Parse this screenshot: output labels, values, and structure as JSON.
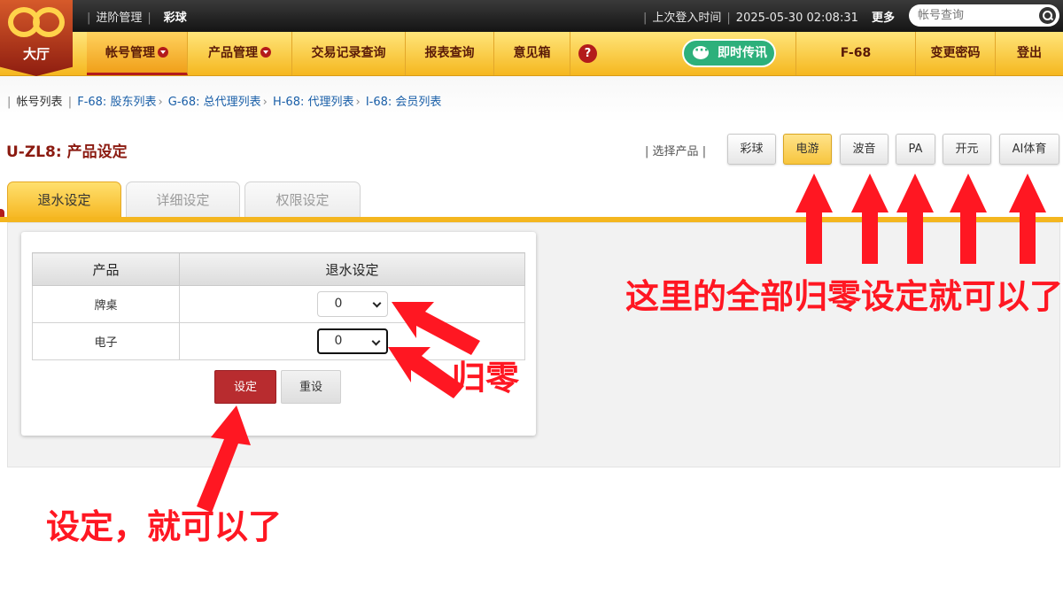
{
  "top_bar": {
    "nav_advanced": "进阶管理",
    "nav_lottery": "彩球",
    "last_login_label": "上次登入时间",
    "last_login_time": "2025-05-30 02:08:31",
    "more": "更多",
    "search_placeholder": "帐号查询"
  },
  "logo": {
    "name": "大厅"
  },
  "nav": {
    "account_mgmt": "帐号管理",
    "product_mgmt": "产品管理",
    "transactions": "交易记录查询",
    "reports": "报表查询",
    "feedback": "意见箱",
    "help": "?",
    "live_chat": "即时传讯",
    "user": "F-68",
    "change_password": "变更密码",
    "logout": "登出"
  },
  "breadcrumb": {
    "root": "帐号列表",
    "items": [
      "F-68: 股东列表",
      "G-68: 总代理列表",
      "H-68: 代理列表",
      "I-68: 会员列表"
    ]
  },
  "page_title": "U-ZL8: 产品设定",
  "product_selector": {
    "label": "选择产品",
    "products": [
      "彩球",
      "电游",
      "波音",
      "PA",
      "开元",
      "AI体育"
    ],
    "selected": "电游"
  },
  "tabs": [
    {
      "label": "退水设定",
      "active": true
    },
    {
      "label": "详细设定",
      "active": false
    },
    {
      "label": "权限设定",
      "active": false
    }
  ],
  "rebate_table": {
    "headers": [
      "产品",
      "退水设定"
    ],
    "rows": [
      {
        "product": "牌桌",
        "value": "0"
      },
      {
        "product": "电子",
        "value": "0"
      }
    ]
  },
  "buttons": {
    "submit": "设定",
    "reset": "重设"
  },
  "annotations": {
    "top_right": "这里的全部归零设定就可以了",
    "zero": "归零",
    "submit_hint": "设定，就可以了"
  },
  "colors": {
    "annotation_red": "#ff1722",
    "nav_yellow": "#f5b71f",
    "primary_button": "#b82c2f",
    "title_red": "#8b1a10"
  }
}
